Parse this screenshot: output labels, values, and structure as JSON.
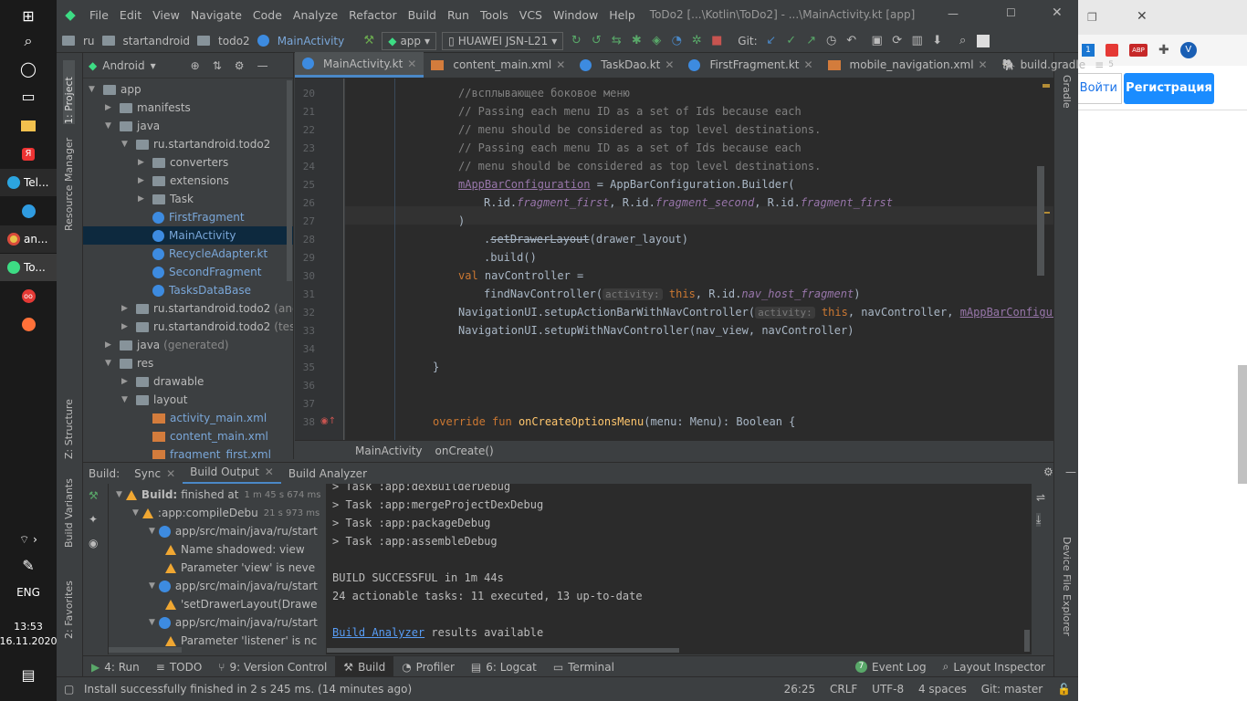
{
  "taskbar": {
    "apps": [
      {
        "label": "Tel..."
      },
      {
        "label": "an..."
      },
      {
        "label": "To..."
      }
    ],
    "lang": "ENG",
    "time": "13:53",
    "date": "16.11.2020"
  },
  "browser": {
    "login_label": "Войти",
    "register_label": "Регистрация",
    "badge_count": "1",
    "abp_count": "3",
    "avatar_letter": "V"
  },
  "ide": {
    "menu": [
      "File",
      "Edit",
      "View",
      "Navigate",
      "Code",
      "Analyze",
      "Refactor",
      "Build",
      "Run",
      "Tools",
      "VCS",
      "Window",
      "Help"
    ],
    "title": "ToDo2 [...\\Kotlin\\ToDo2] - ...\\MainActivity.kt [app]",
    "breadcrumb": [
      "ru",
      "startandroid",
      "todo2",
      "MainActivity"
    ],
    "run_config": "app",
    "device": "HUAWEI JSN-L21",
    "git_label": "Git:",
    "left_stripe": [
      "1: Project",
      "Resource Manager",
      "Z: Structure",
      "Build Variants",
      "2: Favorites"
    ],
    "right_stripe": [
      "Gradle",
      "Device File Explorer"
    ],
    "project_view": "Android",
    "tree": [
      {
        "label": "app",
        "depth": 0,
        "kind": "folder",
        "open": true
      },
      {
        "label": "manifests",
        "depth": 1,
        "kind": "folder",
        "open": false
      },
      {
        "label": "java",
        "depth": 1,
        "kind": "folder",
        "open": true
      },
      {
        "label": "ru.startandroid.todo2",
        "depth": 2,
        "kind": "folder",
        "open": true
      },
      {
        "label": "converters",
        "depth": 3,
        "kind": "folder",
        "open": false
      },
      {
        "label": "extensions",
        "depth": 3,
        "kind": "folder",
        "open": false
      },
      {
        "label": "Task",
        "depth": 3,
        "kind": "folder",
        "open": false
      },
      {
        "label": "FirstFragment",
        "depth": 3,
        "kind": "kt",
        "open": null
      },
      {
        "label": "MainActivity",
        "depth": 3,
        "kind": "kt",
        "open": null
      },
      {
        "label": "RecycleAdapter.kt",
        "depth": 3,
        "kind": "kt",
        "open": null
      },
      {
        "label": "SecondFragment",
        "depth": 3,
        "kind": "kt",
        "open": null
      },
      {
        "label": "TasksDataBase",
        "depth": 3,
        "kind": "kt",
        "open": null
      },
      {
        "label": "ru.startandroid.todo2",
        "suffix": "(androidTe",
        "depth": 2,
        "kind": "folder",
        "open": false
      },
      {
        "label": "ru.startandroid.todo2",
        "suffix": "(test)",
        "depth": 2,
        "kind": "folder",
        "open": false
      },
      {
        "label": "java",
        "suffix": "(generated)",
        "depth": 1,
        "kind": "folder",
        "open": false
      },
      {
        "label": "res",
        "depth": 1,
        "kind": "folder",
        "open": true
      },
      {
        "label": "drawable",
        "depth": 2,
        "kind": "folder",
        "open": false
      },
      {
        "label": "layout",
        "depth": 2,
        "kind": "folder",
        "open": true
      },
      {
        "label": "activity_main.xml",
        "depth": 3,
        "kind": "xml",
        "open": null
      },
      {
        "label": "content_main.xml",
        "depth": 3,
        "kind": "xml",
        "open": null
      },
      {
        "label": "fragment_first.xml",
        "depth": 3,
        "kind": "xml",
        "open": null
      }
    ],
    "tabs": [
      "MainActivity.kt",
      "content_main.xml",
      "TaskDao.kt",
      "FirstFragment.kt",
      "mobile_navigation.xml",
      "build.gradle"
    ],
    "tabs_overflow": "5",
    "editor_breadcrumb": [
      "MainActivity",
      "onCreate()"
    ],
    "line_numbers": [
      "20",
      "21",
      "22",
      "23",
      "24",
      "25",
      "26",
      "27",
      "28",
      "29",
      "30",
      "31",
      "32",
      "33",
      "34",
      "35",
      "36",
      "37",
      "38"
    ],
    "code": {
      "l20": "//всплывающее боковое меню",
      "l21": "// Passing each menu ID as a set of Ids because each",
      "l22": "// menu should be considered as top level destinations.",
      "l23": "// Passing each menu ID as a set of Ids because each",
      "l24": "// menu should be considered as top level destinations.",
      "l25a": "mAppBarConfiguration",
      "l25b": " = AppBarConfiguration.Builder(",
      "l26a": "R.id.",
      "l26b": "fragment_first",
      "l26c": ", R.id.",
      "l26d": "fragment_second",
      "l26e": ", R.id.",
      "l26f": "fragment_first",
      "l27": ")",
      "l28a": ".",
      "l28b": "setDrawerLayout",
      "l28c": "(drawer_layout)",
      "l29": ".build()",
      "l30a": "val",
      "l30b": " navController =",
      "l31a": "findNavController(",
      "l31hint": "activity:",
      "l31b": "this",
      "l31c": ", R.id.",
      "l31d": "nav_host_fragment",
      "l31e": ")",
      "l32a": "NavigationUI.setupActionBarWithNavController(",
      "l32hint": "activity:",
      "l32b": "this",
      "l32c": ", navController, ",
      "l32d": "mAppBarConfiguration",
      "l32e": "!!)",
      "l33": "NavigationUI.setupWithNavController(nav_view, navController)",
      "l35": "}",
      "l38a": "override fun",
      "l38b": "onCreateOptionsMenu",
      "l38c": "(menu: Menu): Boolean {"
    },
    "build": {
      "tabs": [
        "Build:",
        "Sync",
        "Build Output",
        "Build Analyzer"
      ],
      "tree": [
        {
          "label": "Build:",
          "extra": "finished at",
          "time": "1 m 45 s 674 ms",
          "indent": 0
        },
        {
          "label": ":app:compileDebu",
          "time": "21 s 973 ms",
          "indent": 1
        },
        {
          "label": "app/src/main/java/ru/start",
          "indent": 2
        },
        {
          "label": "Name shadowed: view",
          "indent": 3
        },
        {
          "label": "Parameter 'view' is neve",
          "indent": 3
        },
        {
          "label": "app/src/main/java/ru/start",
          "indent": 2
        },
        {
          "label": "'setDrawerLayout(Drawe",
          "indent": 3
        },
        {
          "label": "app/src/main/java/ru/start",
          "indent": 2
        },
        {
          "label": "Parameter 'listener' is nc",
          "indent": 3
        }
      ],
      "output": [
        "> Task :app:dexBuilderDebug",
        "> Task :app:mergeProjectDexDebug",
        "> Task :app:packageDebug",
        "> Task :app:assembleDebug",
        "",
        "BUILD SUCCESSFUL in 1m 44s",
        "24 actionable tasks: 11 executed, 13 up-to-date"
      ],
      "analyzer_link": "Build Analyzer",
      "analyzer_rest": " results available"
    },
    "bottom_tabs": [
      "4: Run",
      "TODO",
      "9: Version Control",
      "Build",
      "Profiler",
      "6: Logcat",
      "Terminal"
    ],
    "event_log": "Event Log",
    "event_count": "7",
    "layout_inspector": "Layout Inspector",
    "status": {
      "message": "Install successfully finished in 2 s 245 ms. (14 minutes ago)",
      "position": "26:25",
      "line_sep": "CRLF",
      "encoding": "UTF-8",
      "indent": "4 spaces",
      "git": "Git: master"
    }
  }
}
